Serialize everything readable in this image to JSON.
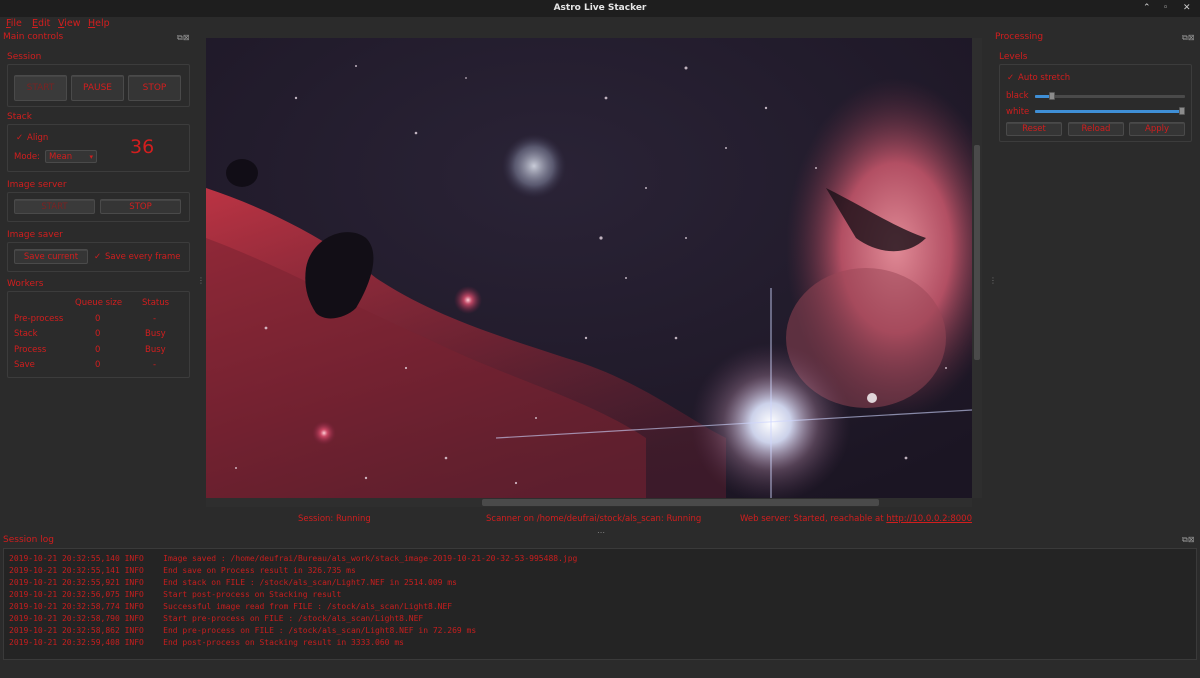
{
  "window": {
    "title": "Astro Live Stacker",
    "controls": [
      "⌃",
      "◦",
      "✕"
    ]
  },
  "menu": {
    "items": [
      {
        "label": "File",
        "accel": "F",
        "rest": "ile"
      },
      {
        "label": "Edit",
        "accel": "E",
        "rest": "dit"
      },
      {
        "label": "View",
        "accel": "V",
        "rest": "iew"
      },
      {
        "label": "Help",
        "accel": "H",
        "rest": "elp"
      }
    ]
  },
  "main_controls": {
    "title": "Main controls",
    "session": {
      "title": "Session",
      "start": "START",
      "pause": "PAUSE",
      "stop": "STOP"
    },
    "stack": {
      "title": "Stack",
      "align_label": "Align",
      "align_check": "✓",
      "mode_label": "Mode:",
      "mode_value": "Mean",
      "counter": "36"
    },
    "image_server": {
      "title": "Image server",
      "start": "START",
      "stop": "STOP"
    },
    "image_saver": {
      "title": "Image saver",
      "save_current": "Save current",
      "save_every_check": "✓",
      "save_every": "Save every frame"
    },
    "workers": {
      "title": "Workers",
      "col_queue": "Queue size",
      "col_status": "Status",
      "rows": [
        {
          "name": "Pre-process",
          "queue": "0",
          "status": "-"
        },
        {
          "name": "Stack",
          "queue": "0",
          "status": "Busy"
        },
        {
          "name": "Process",
          "queue": "0",
          "status": "Busy"
        },
        {
          "name": "Save",
          "queue": "0",
          "status": "-"
        }
      ]
    }
  },
  "processing": {
    "title": "Processing",
    "levels": {
      "title": "Levels",
      "auto_check": "✓",
      "auto_stretch": "Auto stretch",
      "black_label": "black",
      "white_label": "white",
      "black_level": 0.1,
      "white_level": 1.0,
      "reset": "Reset",
      "reload": "Reload",
      "apply": "Apply"
    }
  },
  "status_bar": {
    "session": "Session: Running",
    "scanner": "Scanner on /home/deufrai/stock/als_scan: Running",
    "web_prefix": "Web server: Started, reachable at ",
    "web_link": "http://10.0.0.2:8000"
  },
  "session_log": {
    "title": "Session log",
    "lines": [
      "2019-10-21 20:32:55,140 INFO    Image saved : /home/deufrai/Bureau/als_work/stack_image-2019-10-21-20-32-53-995488.jpg",
      "2019-10-21 20:32:55,141 INFO    End save on Process result in 326.735 ms",
      "2019-10-21 20:32:55,921 INFO    End stack on FILE : /stock/als_scan/Light7.NEF in 2514.009 ms",
      "2019-10-21 20:32:56,075 INFO    Start post-process on Stacking result",
      "2019-10-21 20:32:58,774 INFO    Successful image read from FILE : /stock/als_scan/Light8.NEF",
      "2019-10-21 20:32:58,790 INFO    Start pre-process on FILE : /stock/als_scan/Light8.NEF",
      "2019-10-21 20:32:58,862 INFO    End pre-process on FILE : /stock/als_scan/Light8.NEF in 72.269 ms",
      "2019-10-21 20:32:59,408 INFO    End post-process on Stacking result in 3333.060 ms"
    ]
  },
  "colors": {
    "accent": "#d21e1e",
    "background": "#2b2b2b",
    "slider": "#3f8fd6"
  }
}
